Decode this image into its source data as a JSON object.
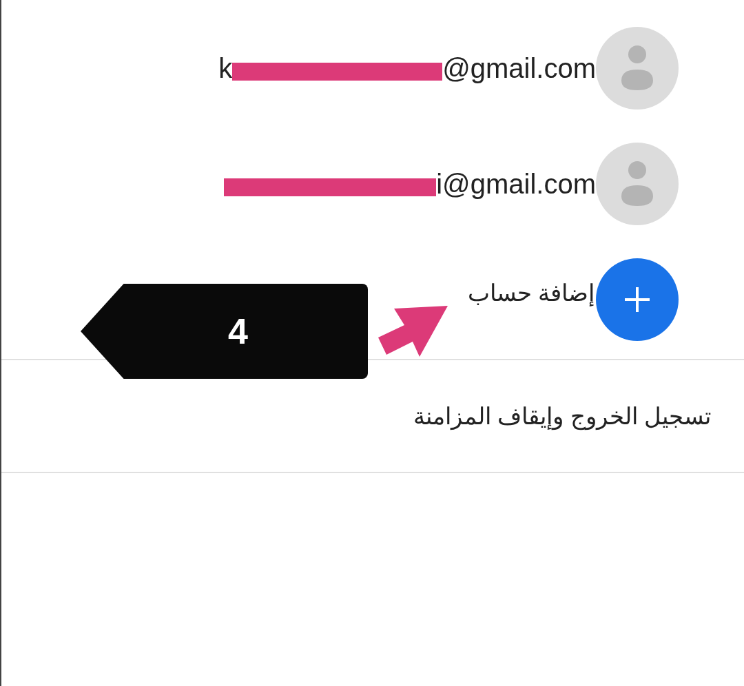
{
  "accounts": [
    {
      "visible_start": "k",
      "visible_end": "@gmail.com",
      "redacted": true
    },
    {
      "visible_end": "i@gmail.com",
      "redacted": true
    }
  ],
  "add_account": {
    "label": "إضافة حساب"
  },
  "sign_out": {
    "label": "تسجيل الخروج وإيقاف المزامنة"
  },
  "annotation": {
    "label": "4"
  }
}
